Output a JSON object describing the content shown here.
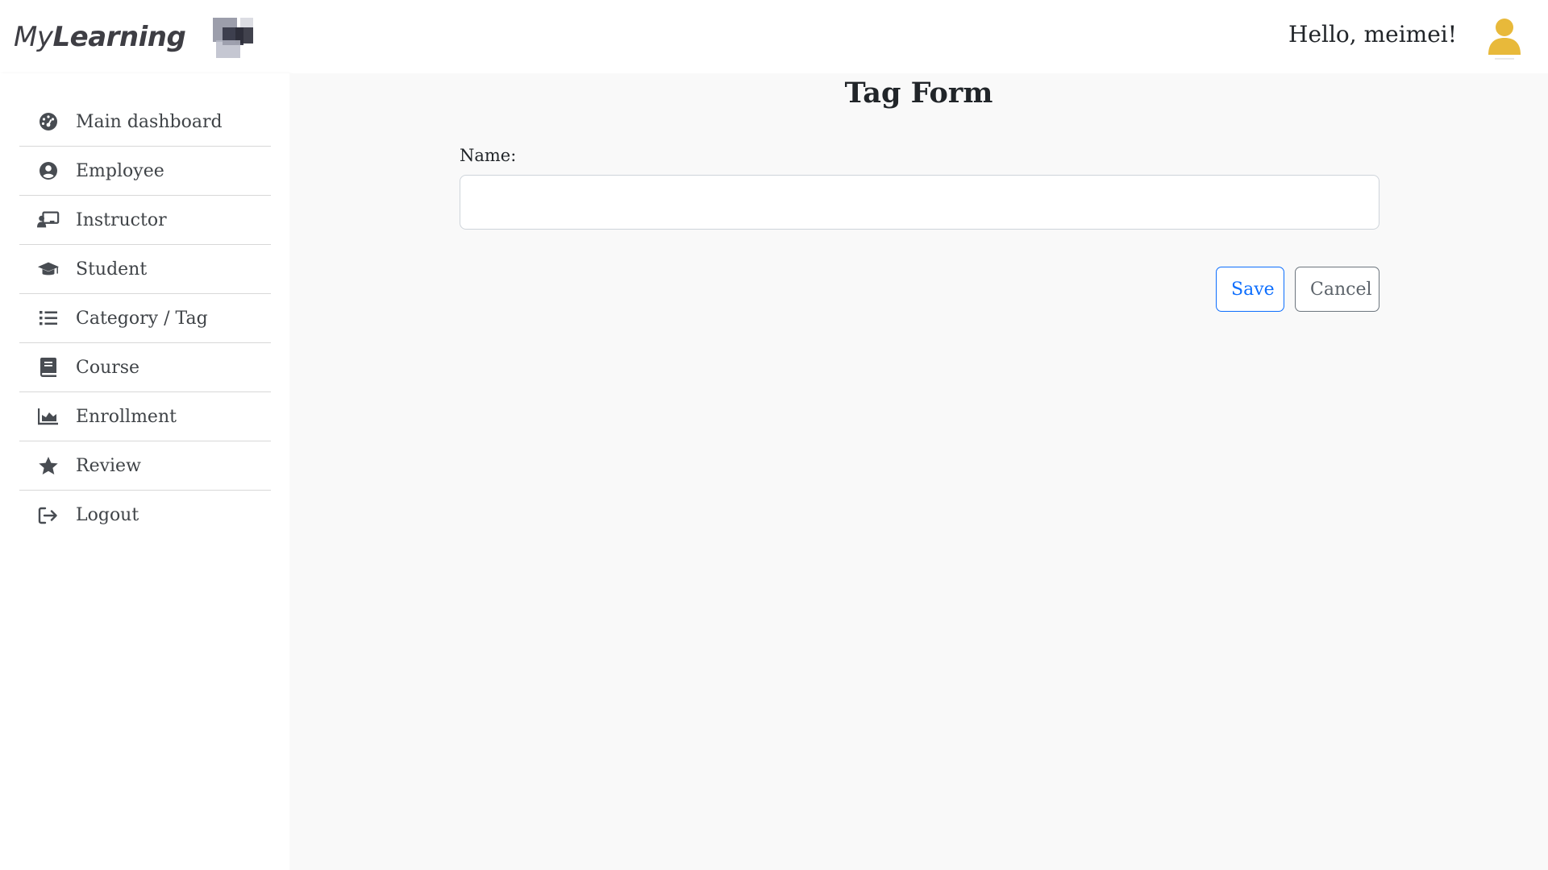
{
  "brand": {
    "name_part1": "My",
    "name_part2": "Learning"
  },
  "header": {
    "greeting": "Hello, meimei!",
    "avatar_icon": "user-avatar-icon",
    "avatar_color": "#e8b93a"
  },
  "sidebar": {
    "items": [
      {
        "label": "Main dashboard",
        "icon": "dashboard-gauge-icon"
      },
      {
        "label": "Employee",
        "icon": "user-circle-icon"
      },
      {
        "label": "Instructor",
        "icon": "chalkboard-teacher-icon"
      },
      {
        "label": "Student",
        "icon": "graduation-cap-icon"
      },
      {
        "label": "Category / Tag",
        "icon": "list-icon"
      },
      {
        "label": "Course",
        "icon": "book-icon"
      },
      {
        "label": "Enrollment",
        "icon": "area-chart-icon"
      },
      {
        "label": "Review",
        "icon": "star-icon"
      },
      {
        "label": "Logout",
        "icon": "logout-icon"
      }
    ]
  },
  "form": {
    "title": "Tag Form",
    "name_label": "Name:",
    "name_value": "",
    "save_label": "Save",
    "cancel_label": "Cancel"
  },
  "colors": {
    "primary": "#0d6efd",
    "secondary": "#6c757d",
    "main_bg": "#f9f9f9"
  }
}
